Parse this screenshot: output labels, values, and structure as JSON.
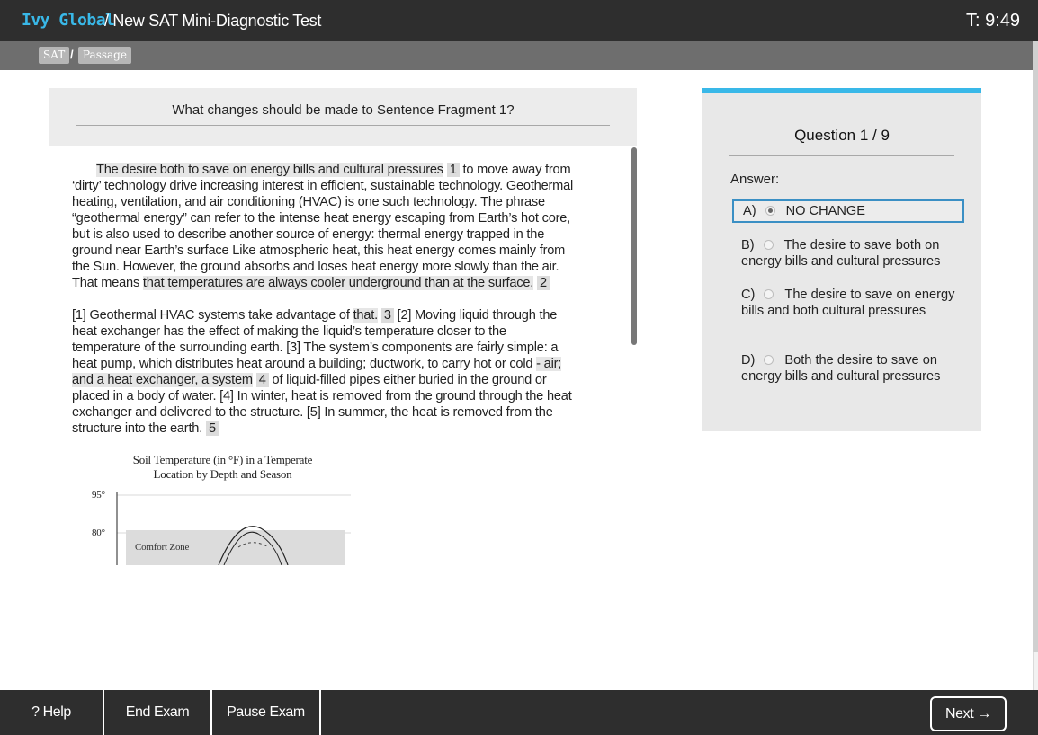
{
  "header": {
    "brand": "Ivy Global",
    "title": "/ New SAT Mini-Diagnostic Test",
    "timer": "T: 9:49"
  },
  "breadcrumb": {
    "items": [
      "SAT",
      "Passage"
    ],
    "separator": "/"
  },
  "question_header": "What changes should be made to Sentence Fragment 1?",
  "passage": {
    "p1": {
      "h1": "The desire both to save on energy bills and cultural pressures",
      "n1": "1",
      "t1": " to move away from ‘dirty’ technology drive increasing interest in efficient, sustainable technology. Geothermal heating, ventilation, and air conditioning (HVAC) is one such technology. The phrase “geothermal energy” can refer to the intense heat energy escaping from Earth’s hot core, but is also used to describe another source of energy: thermal energy trapped in the ground near Earth’s surface Like atmospheric heat, this heat energy comes mainly from the Sun. However, the ground absorbs and loses heat energy more slowly than the air. That means ",
      "h2": "that temperatures are always cooler underground than at the surface.",
      "n2": "2"
    },
    "p2": {
      "t1": "[1] Geothermal HVAC systems take advantage of ",
      "h1": "that.",
      "n3": "3",
      "t2": " [2] Moving liquid through the heat exchanger has the effect of making the liquid’s temperature closer to the temperature of the surrounding earth. [3] The system’s components are fairly simple: a heat pump, which distributes heat around a building; ductwork, to carry hot or cold ",
      "h2": "- air; and a heat exchanger, a system",
      "n4": "4",
      "t3": " of liquid-filled pipes either buried in the ground or placed in a body of water. [4] In winter, heat is removed from the ground through the heat exchanger and delivered to the structure. [5] In summer, the heat is removed from the structure into the earth.",
      "n5": "5"
    }
  },
  "chart_data": {
    "type": "line",
    "title": "Soil Temperature (in °F) in a Temperate Location by Depth and Season",
    "ytick_labels": [
      "95°",
      "80°"
    ],
    "annotations": [
      "Comfort Zone"
    ]
  },
  "right_panel": {
    "question_count": "Question 1 / 9",
    "answer_label": "Answer:",
    "options": [
      {
        "letter": "A)",
        "text": "NO CHANGE",
        "selected": true
      },
      {
        "letter": "B)",
        "text": "The desire to save both on energy bills and cultural pressures",
        "selected": false
      },
      {
        "letter": "C)",
        "text": "The desire to save on energy bills and both cultural pressures",
        "selected": false
      },
      {
        "letter": "D)",
        "text": "Both the desire to save on energy bills and cultural pressures",
        "selected": false
      }
    ],
    "accent_color": "#39b8e8"
  },
  "footer": {
    "help": "? Help",
    "end_exam": "End Exam",
    "pause_exam": "Pause Exam",
    "next": "Next →"
  }
}
